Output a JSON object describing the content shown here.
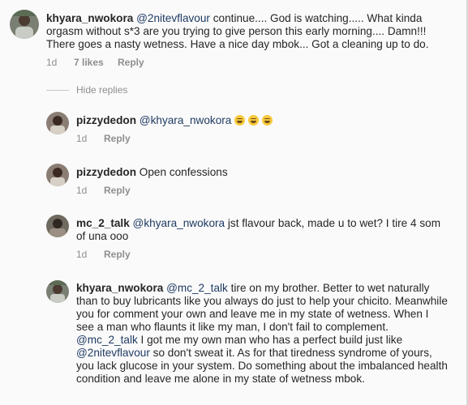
{
  "comments": [
    {
      "username": "khyara_nwokora",
      "mention": "@2nitevflavour",
      "text": " continue.... God is watching..... What kinda orgasm without s*3 are you trying to give person this early morning.... Damn!!! There goes a nasty wetness. Have a nice day mbok... Got a cleaning up to do.",
      "time": "1d",
      "likes": "7 likes",
      "reply": "Reply"
    },
    {
      "username": "pizzydedon",
      "mention": "@khyara_nwokora",
      "text": "",
      "emoji_count": 3,
      "time": "1d",
      "reply": "Reply"
    },
    {
      "username": "pizzydedon",
      "mention": "",
      "text": "Open confessions",
      "time": "1d",
      "reply": "Reply"
    },
    {
      "username": "mc_2_talk",
      "mention": "@khyara_nwokora",
      "text": "  jst flavour back, made u to wet? I tire 4 som of una ooo",
      "time": "1d",
      "reply": "Reply"
    },
    {
      "username": "khyara_nwokora",
      "mention": "@mc_2_talk",
      "text_a": " tire on my brother. Better to wet naturally than to buy lubricants like you always do just to help your chicito. Meanwhile you for comment your own and leave me in my state of wetness. When I see a man who  flaunts it like my man, I don't fail to complement. ",
      "mention_b": "@mc_2_talk",
      "text_b": " I got me my own man who has a perfect build just like ",
      "mention_c": "@2nitevflavour",
      "text_c": " so don't sweat it. As for that tiredness syndrome of yours, you lack glucose in your system. Do something about the imbalanced health condition and leave me alone in my state of wetness mbok."
    }
  ],
  "hide_replies": "Hide replies",
  "icons": {
    "avatar_1": "avatar-icon",
    "emoji": "laughing-emoji-icon"
  }
}
